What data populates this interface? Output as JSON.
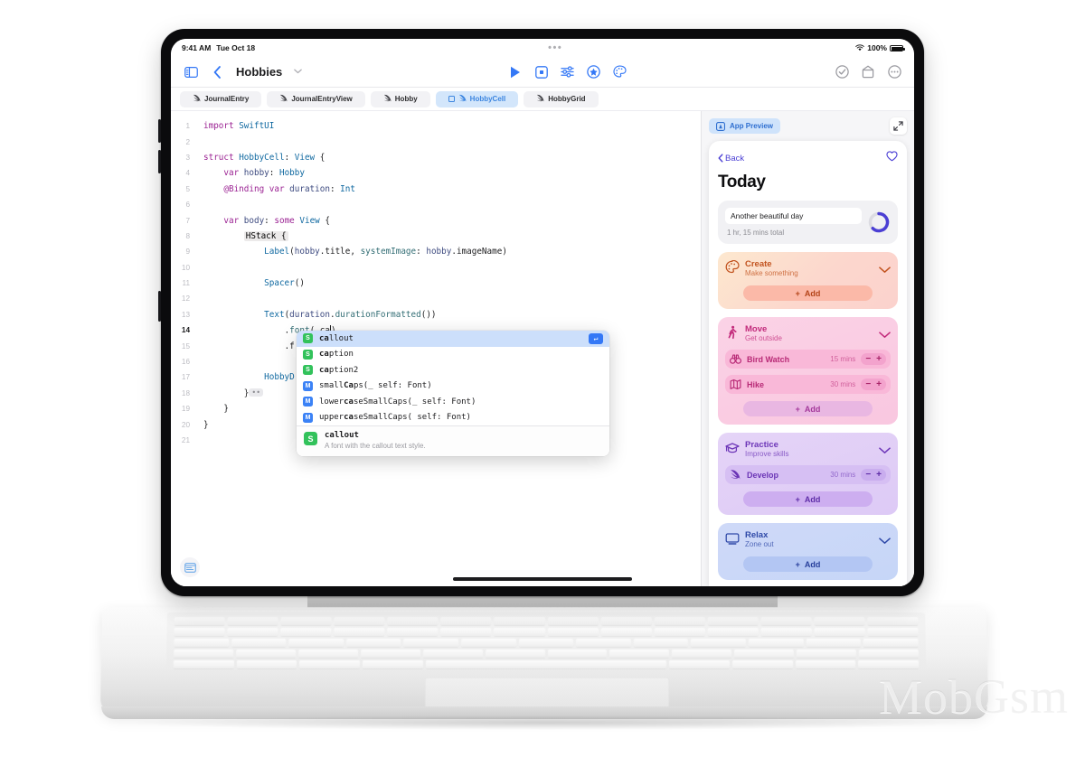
{
  "watermark": "MobGsm",
  "status_bar": {
    "time": "9:41 AM",
    "date": "Tue Oct 18",
    "center_dots": "•••",
    "wifi_icon": "wifi-icon",
    "battery_percent": "100%",
    "battery_icon": "battery-full-icon"
  },
  "toolbar": {
    "sidebar_icon": "sidebar-toggle-icon",
    "back_icon": "chevron-left-icon",
    "project_title": "Hobbies",
    "project_chevron_icon": "chevron-down-icon",
    "run_icon": "play-icon",
    "stop_icon": "stop-square-icon",
    "adjust_icon": "sliders-icon",
    "star_icon": "star-circle-icon",
    "palette_icon": "palette-icon",
    "check_icon": "checkmark-circle-icon",
    "library_icon": "library-icon",
    "more_icon": "ellipsis-circle-icon"
  },
  "tabs": [
    {
      "label": "JournalEntry",
      "icon": "swift-file-icon",
      "active": false
    },
    {
      "label": "JournalEntryView",
      "icon": "swift-file-icon",
      "active": false
    },
    {
      "label": "Hobby",
      "icon": "swift-file-icon",
      "active": false
    },
    {
      "label": "HobbyCell",
      "icon": "swift-file-icon",
      "active": true
    },
    {
      "label": "HobbyGrid",
      "icon": "swift-file-icon",
      "active": false
    }
  ],
  "editor": {
    "minimap_icon": "document-minimap-icon",
    "lines": [
      {
        "n": "1",
        "tokens": [
          {
            "t": "import ",
            "c": "kw"
          },
          {
            "t": "SwiftUI",
            "c": "ty"
          }
        ]
      },
      {
        "n": "2",
        "tokens": []
      },
      {
        "n": "3",
        "tokens": [
          {
            "t": "struct ",
            "c": "kw"
          },
          {
            "t": "HobbyCell",
            "c": "ty"
          },
          {
            "t": ": ",
            "c": "id"
          },
          {
            "t": "View",
            "c": "ty"
          },
          {
            "t": " {",
            "c": "id"
          }
        ]
      },
      {
        "n": "4",
        "tokens": [
          {
            "t": "    ",
            "c": "id"
          },
          {
            "t": "var ",
            "c": "kw"
          },
          {
            "t": "hobby",
            "c": "prop"
          },
          {
            "t": ": ",
            "c": "id"
          },
          {
            "t": "Hobby",
            "c": "ty"
          }
        ]
      },
      {
        "n": "5",
        "tokens": [
          {
            "t": "    ",
            "c": "id"
          },
          {
            "t": "@Binding ",
            "c": "at"
          },
          {
            "t": "var ",
            "c": "kw"
          },
          {
            "t": "duration",
            "c": "prop"
          },
          {
            "t": ": ",
            "c": "id"
          },
          {
            "t": "Int",
            "c": "ty"
          }
        ]
      },
      {
        "n": "6",
        "tokens": []
      },
      {
        "n": "7",
        "tokens": [
          {
            "t": "    ",
            "c": "id"
          },
          {
            "t": "var ",
            "c": "kw"
          },
          {
            "t": "body",
            "c": "prop"
          },
          {
            "t": ": ",
            "c": "id"
          },
          {
            "t": "some ",
            "c": "kw"
          },
          {
            "t": "View",
            "c": "ty"
          },
          {
            "t": " {",
            "c": "id"
          }
        ]
      },
      {
        "n": "8",
        "tokens": [
          {
            "t": "        ",
            "c": "id"
          },
          {
            "t": "HStack {",
            "c": "hl"
          }
        ]
      },
      {
        "n": "9",
        "tokens": [
          {
            "t": "            ",
            "c": "id"
          },
          {
            "t": "Label",
            "c": "ty"
          },
          {
            "t": "(",
            "c": "id"
          },
          {
            "t": "hobby",
            "c": "prop"
          },
          {
            "t": ".title, ",
            "c": "id"
          },
          {
            "t": "systemImage",
            "c": "fn"
          },
          {
            "t": ": ",
            "c": "id"
          },
          {
            "t": "hobby",
            "c": "prop"
          },
          {
            "t": ".imageName)",
            "c": "id"
          }
        ]
      },
      {
        "n": "10",
        "tokens": []
      },
      {
        "n": "11",
        "tokens": [
          {
            "t": "            ",
            "c": "id"
          },
          {
            "t": "Spacer",
            "c": "ty"
          },
          {
            "t": "()",
            "c": "id"
          }
        ]
      },
      {
        "n": "12",
        "tokens": []
      },
      {
        "n": "13",
        "tokens": [
          {
            "t": "            ",
            "c": "id"
          },
          {
            "t": "Text",
            "c": "ty"
          },
          {
            "t": "(",
            "c": "id"
          },
          {
            "t": "duration",
            "c": "prop"
          },
          {
            "t": ".",
            "c": "id"
          },
          {
            "t": "durationFormatted",
            "c": "fn"
          },
          {
            "t": "())",
            "c": "id"
          }
        ]
      },
      {
        "n": "14",
        "tokens": [
          {
            "t": "                ",
            "c": "id"
          },
          {
            "t": ".",
            "c": "id"
          },
          {
            "t": "font",
            "c": "fn"
          },
          {
            "t": "(.ca",
            "c": "id"
          }
        ],
        "caret": true,
        "current": true,
        "tail": ")"
      },
      {
        "n": "15",
        "tokens": [
          {
            "t": "                ",
            "c": "id"
          },
          {
            "t": ".f",
            "c": "id"
          }
        ]
      },
      {
        "n": "16",
        "tokens": []
      },
      {
        "n": "17",
        "tokens": [
          {
            "t": "            ",
            "c": "id"
          },
          {
            "t": "HobbyD",
            "c": "ty"
          }
        ]
      },
      {
        "n": "18",
        "tokens": [
          {
            "t": "        ",
            "c": "id"
          },
          {
            "t": "}",
            "c": "id"
          },
          {
            "t": "••",
            "c": "fold"
          }
        ]
      },
      {
        "n": "19",
        "tokens": [
          {
            "t": "    ",
            "c": "id"
          },
          {
            "t": "}",
            "c": "id"
          }
        ]
      },
      {
        "n": "20",
        "tokens": [
          {
            "t": "}",
            "c": "id"
          }
        ]
      },
      {
        "n": "21",
        "tokens": []
      }
    ]
  },
  "autocomplete": {
    "items": [
      {
        "kind": "S",
        "match": "ca",
        "rest": "llout",
        "selected": true,
        "return_key": "↵"
      },
      {
        "kind": "S",
        "match": "ca",
        "rest": "ption",
        "selected": false
      },
      {
        "kind": "S",
        "match": "ca",
        "rest": "ption2",
        "selected": false
      },
      {
        "kind": "M",
        "pre": "small",
        "match": "Ca",
        "rest": "ps(_ self: Font)",
        "selected": false
      },
      {
        "kind": "M",
        "pre": "lower",
        "match": "ca",
        "rest": "seSmallCaps(_ self: Font)",
        "selected": false
      },
      {
        "kind": "M",
        "pre": "upper",
        "match": "ca",
        "rest": "seSmallCaps( self: Font)",
        "selected": false
      }
    ],
    "footer": {
      "kind": "S",
      "title": "callout",
      "description": "A font with the callout text style."
    }
  },
  "preview": {
    "pill_label": "App Preview",
    "pill_icon": "preview-app-icon",
    "expand_icon": "expand-diagonal-icon",
    "back_label": "Back",
    "back_icon": "chevron-left-icon",
    "favorite_icon": "heart-icon",
    "title": "Today",
    "summary": {
      "entry_value": "Another beautiful day",
      "total_label": "1 hr, 15 mins total",
      "progress_icon": "progress-ring-icon"
    },
    "cards": [
      {
        "id": "create",
        "title": "Create",
        "subtitle": "Make something",
        "icon": "palette-icon",
        "chevron_icon": "chevron-down-icon",
        "items": [],
        "add_label": "Add",
        "add_icon": "plus-icon"
      },
      {
        "id": "move",
        "title": "Move",
        "subtitle": "Get outside",
        "icon": "figure-walk-icon",
        "chevron_icon": "chevron-down-icon",
        "items": [
          {
            "name": "Bird Watch",
            "icon": "binoculars-icon",
            "duration": "15 mins",
            "minus": "−",
            "plus": "+"
          },
          {
            "name": "Hike",
            "icon": "map-icon",
            "duration": "30 mins",
            "minus": "−",
            "plus": "+"
          }
        ],
        "add_label": "Add",
        "add_icon": "plus-icon"
      },
      {
        "id": "practice",
        "title": "Practice",
        "subtitle": "Improve skills",
        "icon": "graduationcap-icon",
        "chevron_icon": "chevron-down-icon",
        "items": [
          {
            "name": "Develop",
            "icon": "swift-file-icon",
            "duration": "30 mins",
            "minus": "−",
            "plus": "+"
          }
        ],
        "add_label": "Add",
        "add_icon": "plus-icon"
      },
      {
        "id": "relax",
        "title": "Relax",
        "subtitle": "Zone out",
        "icon": "tv-icon",
        "chevron_icon": "chevron-down-icon",
        "items": [],
        "add_label": "Add",
        "add_icon": "plus-icon"
      }
    ]
  },
  "colors": {
    "accent_blue": "#3478f6",
    "tab_active_bg": "#d3e6fb",
    "selection_blue": "#ccdffb",
    "kind_struct_green": "#32c25b",
    "kind_method_blue": "#3b82f6",
    "preview_purple": "#4b3fd4"
  }
}
